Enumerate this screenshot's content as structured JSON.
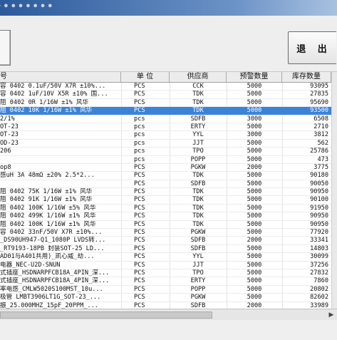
{
  "window": {
    "title": "••••••••"
  },
  "toolbar": {
    "exit_label": "退 出"
  },
  "grid": {
    "columns": [
      "号",
      "单 位",
      "供应商",
      "预警数量",
      "库存数量"
    ],
    "rows": [
      {
        "desc": "容 0402 0.1uF/50V X7R ±10%...",
        "unit": "PCS",
        "supplier": "CCK",
        "alert": "5000",
        "stock": "93095"
      },
      {
        "desc": "容 0402 1uF/10V X5R ±10% 国...",
        "unit": "PCS",
        "supplier": "TDK",
        "alert": "5000",
        "stock": "27835"
      },
      {
        "desc": "阻 0402 0R 1/16W ±1% 风华",
        "unit": "PCS",
        "supplier": "TDK",
        "alert": "5000",
        "stock": "95690"
      },
      {
        "desc": "阻 0402 10K 1/16W ±1% 风华",
        "unit": "PCS",
        "supplier": "TDK",
        "alert": "5000",
        "stock": "93500"
      },
      {
        "desc": "2/1%",
        "unit": "pcs",
        "supplier": "SDFB",
        "alert": "3000",
        "stock": "6508"
      },
      {
        "desc": "OT-23",
        "unit": "pcs",
        "supplier": "ERTY",
        "alert": "5000",
        "stock": "2710"
      },
      {
        "desc": "OT-23",
        "unit": "pcs",
        "supplier": "YYL",
        "alert": "3000",
        "stock": "3812"
      },
      {
        "desc": "OD-23",
        "unit": "pcs",
        "supplier": "JJT",
        "alert": "5000",
        "stock": "562"
      },
      {
        "desc": "206",
        "unit": "pcs",
        "supplier": "TPO",
        "alert": "5000",
        "stock": "25786"
      },
      {
        "desc": "",
        "unit": "pcs",
        "supplier": "POPP",
        "alert": "5000",
        "stock": "473"
      },
      {
        "desc": "op8",
        "unit": "PCS",
        "supplier": "PGKW",
        "alert": "2000",
        "stock": "3775"
      },
      {
        "desc": "感uH 3A 48mΩ ±20% 2.5*2...",
        "unit": "PCS",
        "supplier": "TDK",
        "alert": "5000",
        "stock": "90180"
      },
      {
        "desc": "",
        "unit": "PCS",
        "supplier": "SDFB",
        "alert": "5000",
        "stock": "90050"
      },
      {
        "desc": "阻 0402 75K 1/16W ±1% 风华",
        "unit": "PCS",
        "supplier": "TDK",
        "alert": "5000",
        "stock": "90950"
      },
      {
        "desc": "阻 0402 91K 1/16W ±1% 风华",
        "unit": "PCS",
        "supplier": "TDK",
        "alert": "5000",
        "stock": "90100"
      },
      {
        "desc": "阻 0402 100K 1/16W ±5% 风华",
        "unit": "PCS",
        "supplier": "TDK",
        "alert": "5000",
        "stock": "91950"
      },
      {
        "desc": "阻 0402 499K 1/16W ±1% 风华",
        "unit": "PCS",
        "supplier": "TDK",
        "alert": "5000",
        "stock": "90950"
      },
      {
        "desc": "阻 0402 100K 1/16W ±1% 风华",
        "unit": "PCS",
        "supplier": "TDK",
        "alert": "5000",
        "stock": "90950"
      },
      {
        "desc": "容 0402 33nF/50V X7R ±10%...",
        "unit": "PCS",
        "supplier": "PGKW",
        "alert": "5000",
        "stock": "77920"
      },
      {
        "desc": "_DS90UH947-Q1_1080P LVDS转...",
        "unit": "PCS",
        "supplier": "SDFB",
        "alert": "2000",
        "stock": "33341"
      },
      {
        "desc": "_RT9193-18PB 封装SOT-25 LD...",
        "unit": "PCS",
        "supplier": "SDFB",
        "alert": "5000",
        "stock": "14803"
      },
      {
        "desc": "AD01与A401共用)_凯心威_劫...",
        "unit": "PCS",
        "supplier": "YYL",
        "alert": "5000",
        "stock": "30099"
      },
      {
        "desc": "电器_NEC-U2D-SNUN",
        "unit": "PCS",
        "supplier": "JJT",
        "alert": "5000",
        "stock": "37256"
      },
      {
        "desc": "式插座_HSDNARPFCB18A_4PIN_深...",
        "unit": "PCS",
        "supplier": "TPO",
        "alert": "5000",
        "stock": "27832"
      },
      {
        "desc": "式插座_HSDNARPFCB18A_4PIN_深...",
        "unit": "PCS",
        "supplier": "ERTY",
        "alert": "5000",
        "stock": "7860"
      },
      {
        "desc": "率电感_CMLW5020S100MST_10u...",
        "unit": "PCS",
        "supplier": "POPP",
        "alert": "5000",
        "stock": "20802"
      },
      {
        "desc": "极管 LMBT3906LT1G_SOT-23_...",
        "unit": "PCS",
        "supplier": "PGKW",
        "alert": "5000",
        "stock": "82602"
      },
      {
        "desc": "振_25.000MHZ_15pF_20PPM_...",
        "unit": "PCS",
        "supplier": "SDFB",
        "alert": "2000",
        "stock": "33989"
      }
    ]
  }
}
